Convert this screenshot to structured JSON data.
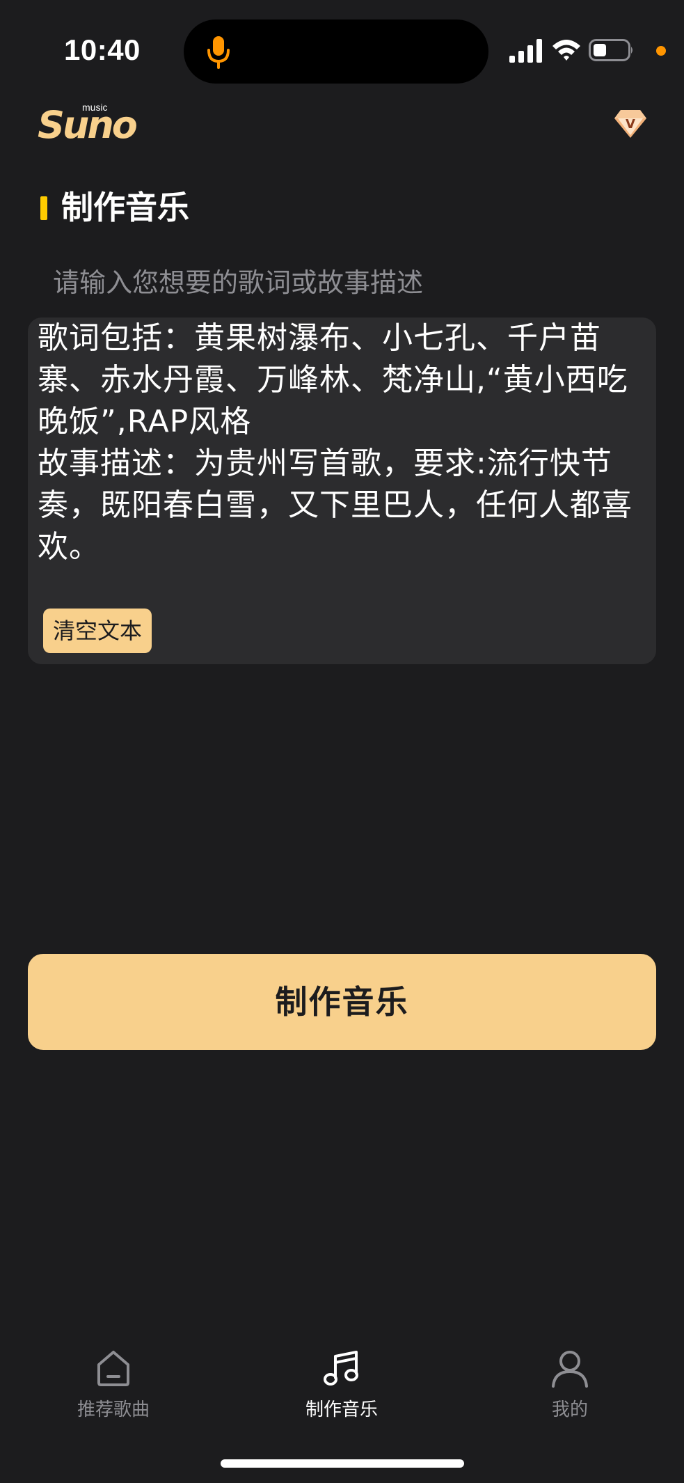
{
  "status_bar": {
    "time": "10:40"
  },
  "colors": {
    "background": "#1c1c1e",
    "card": "#2c2c2e",
    "accent": "#f8d08c",
    "title_marker": "#ffcc00",
    "mic_indicator": "#ff9500",
    "muted_text": "#8e8e93"
  },
  "header": {
    "logo_text": "Suno",
    "logo_subtext": "music",
    "vip_icon": "diamond-v-icon"
  },
  "section": {
    "title": "制作音乐"
  },
  "editor": {
    "placeholder": "请输入您想要的歌词或故事描述",
    "value": "歌词包括：黄果树瀑布、小七孔、千户苗寨、赤水丹霞、万峰林、梵净山,“黄小西吃晚饭”,RAP风格\n故事描述：为贵州写首歌，要求:流行快节奏，既阳春白雪，又下里巴人，任何人都喜欢。",
    "clear_label": "清空文本"
  },
  "action": {
    "make_label": "制作音乐"
  },
  "tab_bar": {
    "tabs": [
      {
        "label": "推荐歌曲",
        "icon": "home-icon",
        "active": false
      },
      {
        "label": "制作音乐",
        "icon": "music-note-icon",
        "active": true
      },
      {
        "label": "我的",
        "icon": "person-icon",
        "active": false
      }
    ]
  }
}
